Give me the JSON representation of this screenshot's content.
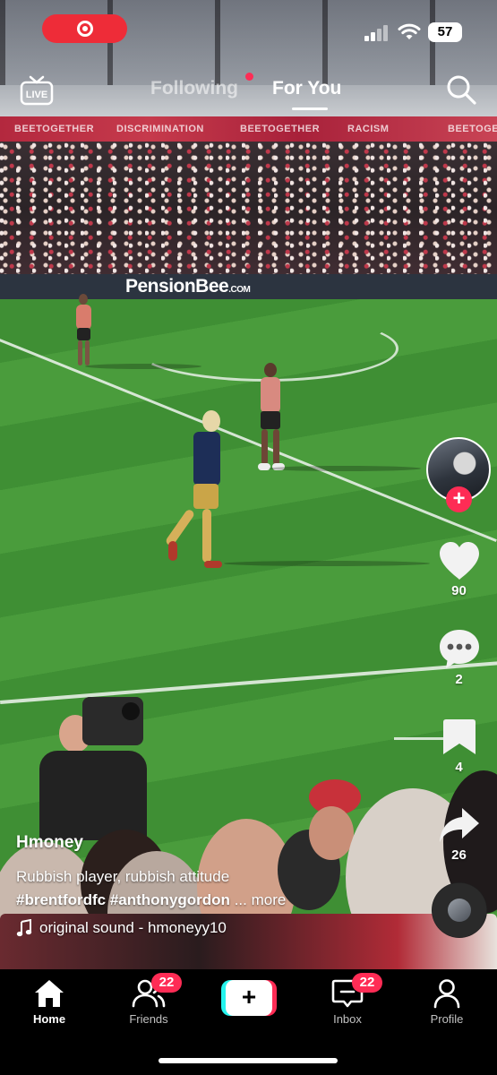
{
  "status_bar": {
    "battery": "57",
    "recording_icon": "record-icon",
    "signal_icon": "cellular-signal-icon",
    "wifi_icon": "wifi-icon"
  },
  "top_nav": {
    "live_label": "LIVE",
    "tabs": [
      {
        "label": "Following"
      },
      {
        "label": "For You"
      }
    ],
    "search_icon": "search-icon"
  },
  "video_scene": {
    "stadium_banner": [
      "BEETOGETHER",
      "DISCRIMINATION",
      "BEETOGETHER",
      "RACISM",
      "BEETOGETHER"
    ],
    "ad_board": {
      "brand": "PensionBee",
      "suffix": ".COM"
    }
  },
  "actions": {
    "follow_symbol": "+",
    "like_count": "90",
    "comment_count": "2",
    "bookmark_count": "4",
    "share_count": "26"
  },
  "post": {
    "username": "Hmoney",
    "description": "Rubbish player, rubbish attitude",
    "hashtags": "#brentfordfc #anthonygordon",
    "more_label": "... more",
    "sound": "original sound - hmoneyy10"
  },
  "bottom_nav": {
    "home_label": "Home",
    "friends_label": "Friends",
    "friends_badge": "22",
    "create_symbol": "+",
    "inbox_label": "Inbox",
    "inbox_badge": "22",
    "profile_label": "Profile"
  },
  "colors": {
    "accent_red": "#fe2c55",
    "accent_cyan": "#25f4ee",
    "rec_red": "#ee2c38"
  }
}
